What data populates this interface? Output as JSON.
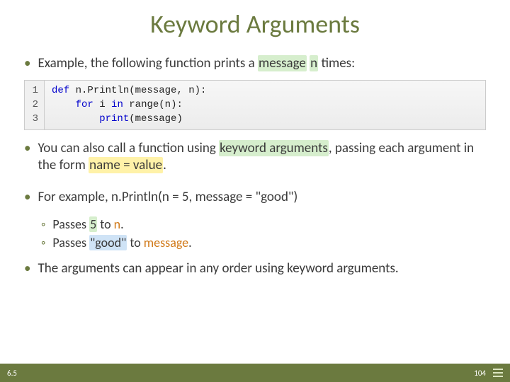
{
  "title": "Keyword Arguments",
  "bullets": {
    "b1_pre": "Example, the following function prints a ",
    "b1_msg": "message",
    "b1_mid": " ",
    "b1_n": "n",
    "b1_post": " times:",
    "b2_pre": "You can also call a function using ",
    "b2_kw": "keyword arguments",
    "b2_mid": ", passing each argument in the form ",
    "b2_nv": "name = value",
    "b2_post": ".",
    "b3": "For example, n.Println(n = 5, message = \"good\")",
    "b4": "The arguments can appear in any order using keyword arguments."
  },
  "code": {
    "ln1": "1",
    "ln2": "2",
    "ln3": "3",
    "l1_kw": "def",
    "l1_rest": " n.Println(message, n):",
    "l2_pre": "    ",
    "l2_kw1": "for",
    "l2_mid": " i ",
    "l2_kw2": "in",
    "l2_rest": " range(n):",
    "l3_pre": "        ",
    "l3_kw": "print",
    "l3_rest": "(message)"
  },
  "sub": {
    "s1_pre": "Passes ",
    "s1_v": "5",
    "s1_mid": " to ",
    "s1_t": "n",
    "s1_post": ".",
    "s2_pre": "Passes ",
    "s2_v": "\"good\"",
    "s2_mid": " to ",
    "s2_t": "message",
    "s2_post": "."
  },
  "footer": {
    "left": "6.5",
    "page": "104"
  }
}
